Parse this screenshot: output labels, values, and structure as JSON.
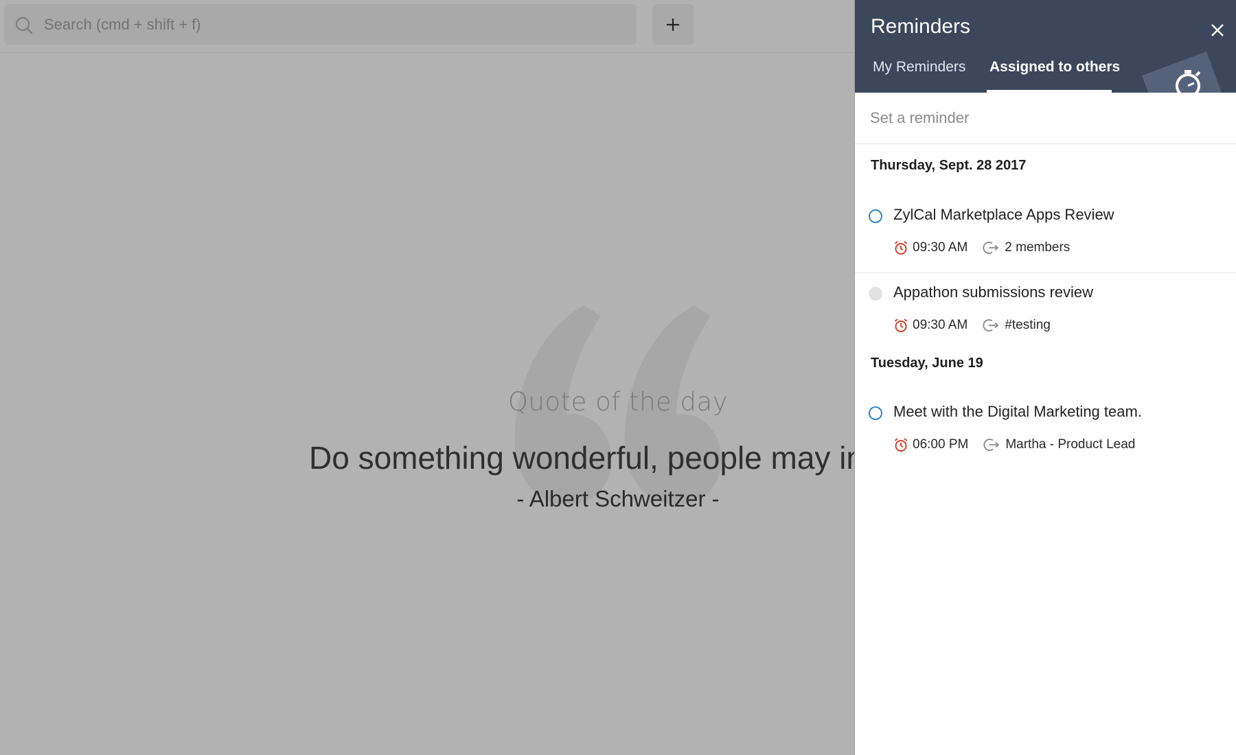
{
  "search": {
    "placeholder": "Search (cmd + shift + f)"
  },
  "toolbar": {
    "add_icon": "plus-icon"
  },
  "quote": {
    "heading": "Quote of the day",
    "text": "Do something wonderful, people may imit",
    "author": "- Albert Schweitzer -"
  },
  "panel": {
    "title": "Reminders",
    "close_icon": "close-icon",
    "tabs": [
      {
        "label": "My Reminders",
        "active": false
      },
      {
        "label": "Assigned to others",
        "active": true
      }
    ],
    "set_reminder": {
      "placeholder": "Set a reminder"
    },
    "groups": [
      {
        "date": "Thursday, Sept. 28 2017",
        "items": [
          {
            "title": "ZylCal Marketplace Apps Review",
            "time": "09:30 AM",
            "assignee": "2 members",
            "status": "open"
          },
          {
            "title": "Appathon submissions review",
            "time": "09:30 AM",
            "assignee": "#testing",
            "status": "done"
          }
        ]
      },
      {
        "date": "Tuesday, June 19",
        "items": [
          {
            "title": "Meet with the Digital Marketing team.",
            "time": "06:00 PM",
            "assignee": "Martha -  Product Lead",
            "status": "open"
          }
        ]
      }
    ]
  },
  "colors": {
    "panel_header": "#3c475c",
    "overlay": "#b2b2b2",
    "alarm": "#d9402b",
    "status_open": "#2f86c9"
  }
}
